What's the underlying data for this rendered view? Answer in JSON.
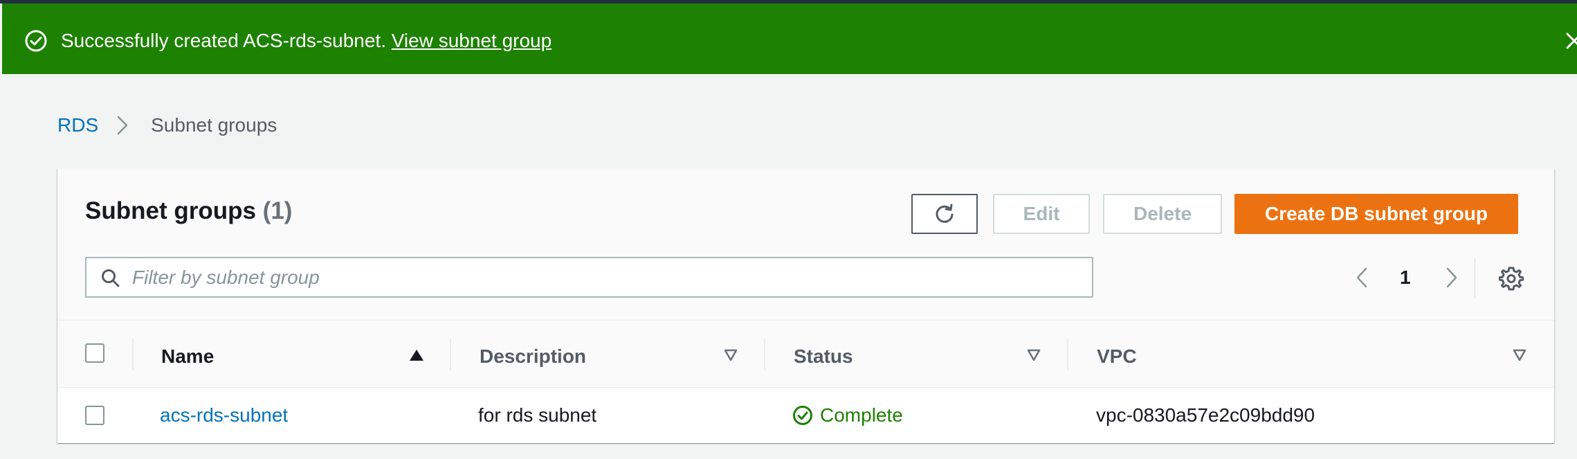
{
  "flash": {
    "message": "Successfully created ACS-rds-subnet.",
    "link_label": "View subnet group",
    "icon": "success-circle-icon",
    "close_icon": "close-icon",
    "color": "#1d8102"
  },
  "breadcrumb": {
    "root": "RDS",
    "current": "Subnet groups"
  },
  "panel": {
    "title": "Subnet groups",
    "count": "(1)",
    "buttons": {
      "refresh_icon": "refresh-icon",
      "edit": "Edit",
      "delete": "Delete",
      "create": "Create DB subnet group"
    },
    "search": {
      "placeholder": "Filter by subnet group",
      "value": ""
    },
    "pagination": {
      "current_page": "1"
    }
  },
  "table": {
    "columns": [
      "Name",
      "Description",
      "Status",
      "VPC"
    ],
    "rows": [
      {
        "name": "acs-rds-subnet",
        "description": "for rds subnet",
        "status": "Complete",
        "vpc": "vpc-0830a57e2c09bdd90"
      }
    ]
  },
  "colors": {
    "primary": "#ec7211",
    "link": "#0073bb",
    "success": "#1d8102"
  }
}
